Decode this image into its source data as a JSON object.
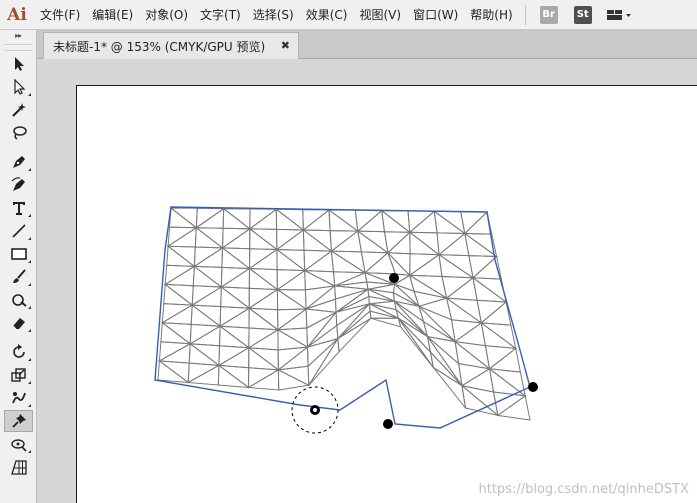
{
  "app": {
    "logo": "Ai"
  },
  "menu": {
    "items": [
      "文件(F)",
      "编辑(E)",
      "对象(O)",
      "文字(T)",
      "选择(S)",
      "效果(C)",
      "视图(V)",
      "窗口(W)",
      "帮助(H)"
    ],
    "bridge_label": "Br",
    "stock_label": "St",
    "workspace_icon": "workspace-grid-icon"
  },
  "toolbar": {
    "collapse_label": "▸▸",
    "tools": [
      "selection-tool",
      "direct-selection-tool",
      "magic-wand-tool",
      "lasso-tool",
      "pen-tool",
      "curvature-tool",
      "type-tool",
      "line-segment-tool",
      "rectangle-tool",
      "paintbrush-tool",
      "shaper-tool",
      "eraser-tool",
      "rotate-tool",
      "scale-tool",
      "warp-tool",
      "puppet-warp-tool",
      "free-transform-tool",
      "perspective-grid-tool"
    ],
    "active_tool": "puppet-warp-tool"
  },
  "document": {
    "tab_title": "未标题-1* @ 153% (CMYK/GPU 预览)",
    "close_label": "✖"
  },
  "canvas": {
    "watermark": "https://blog.csdn.net/qinheDSTX",
    "mesh_stroke_color": "#7a7a7a",
    "outline_color": "#3a5db8",
    "pin_color": "#000000"
  }
}
